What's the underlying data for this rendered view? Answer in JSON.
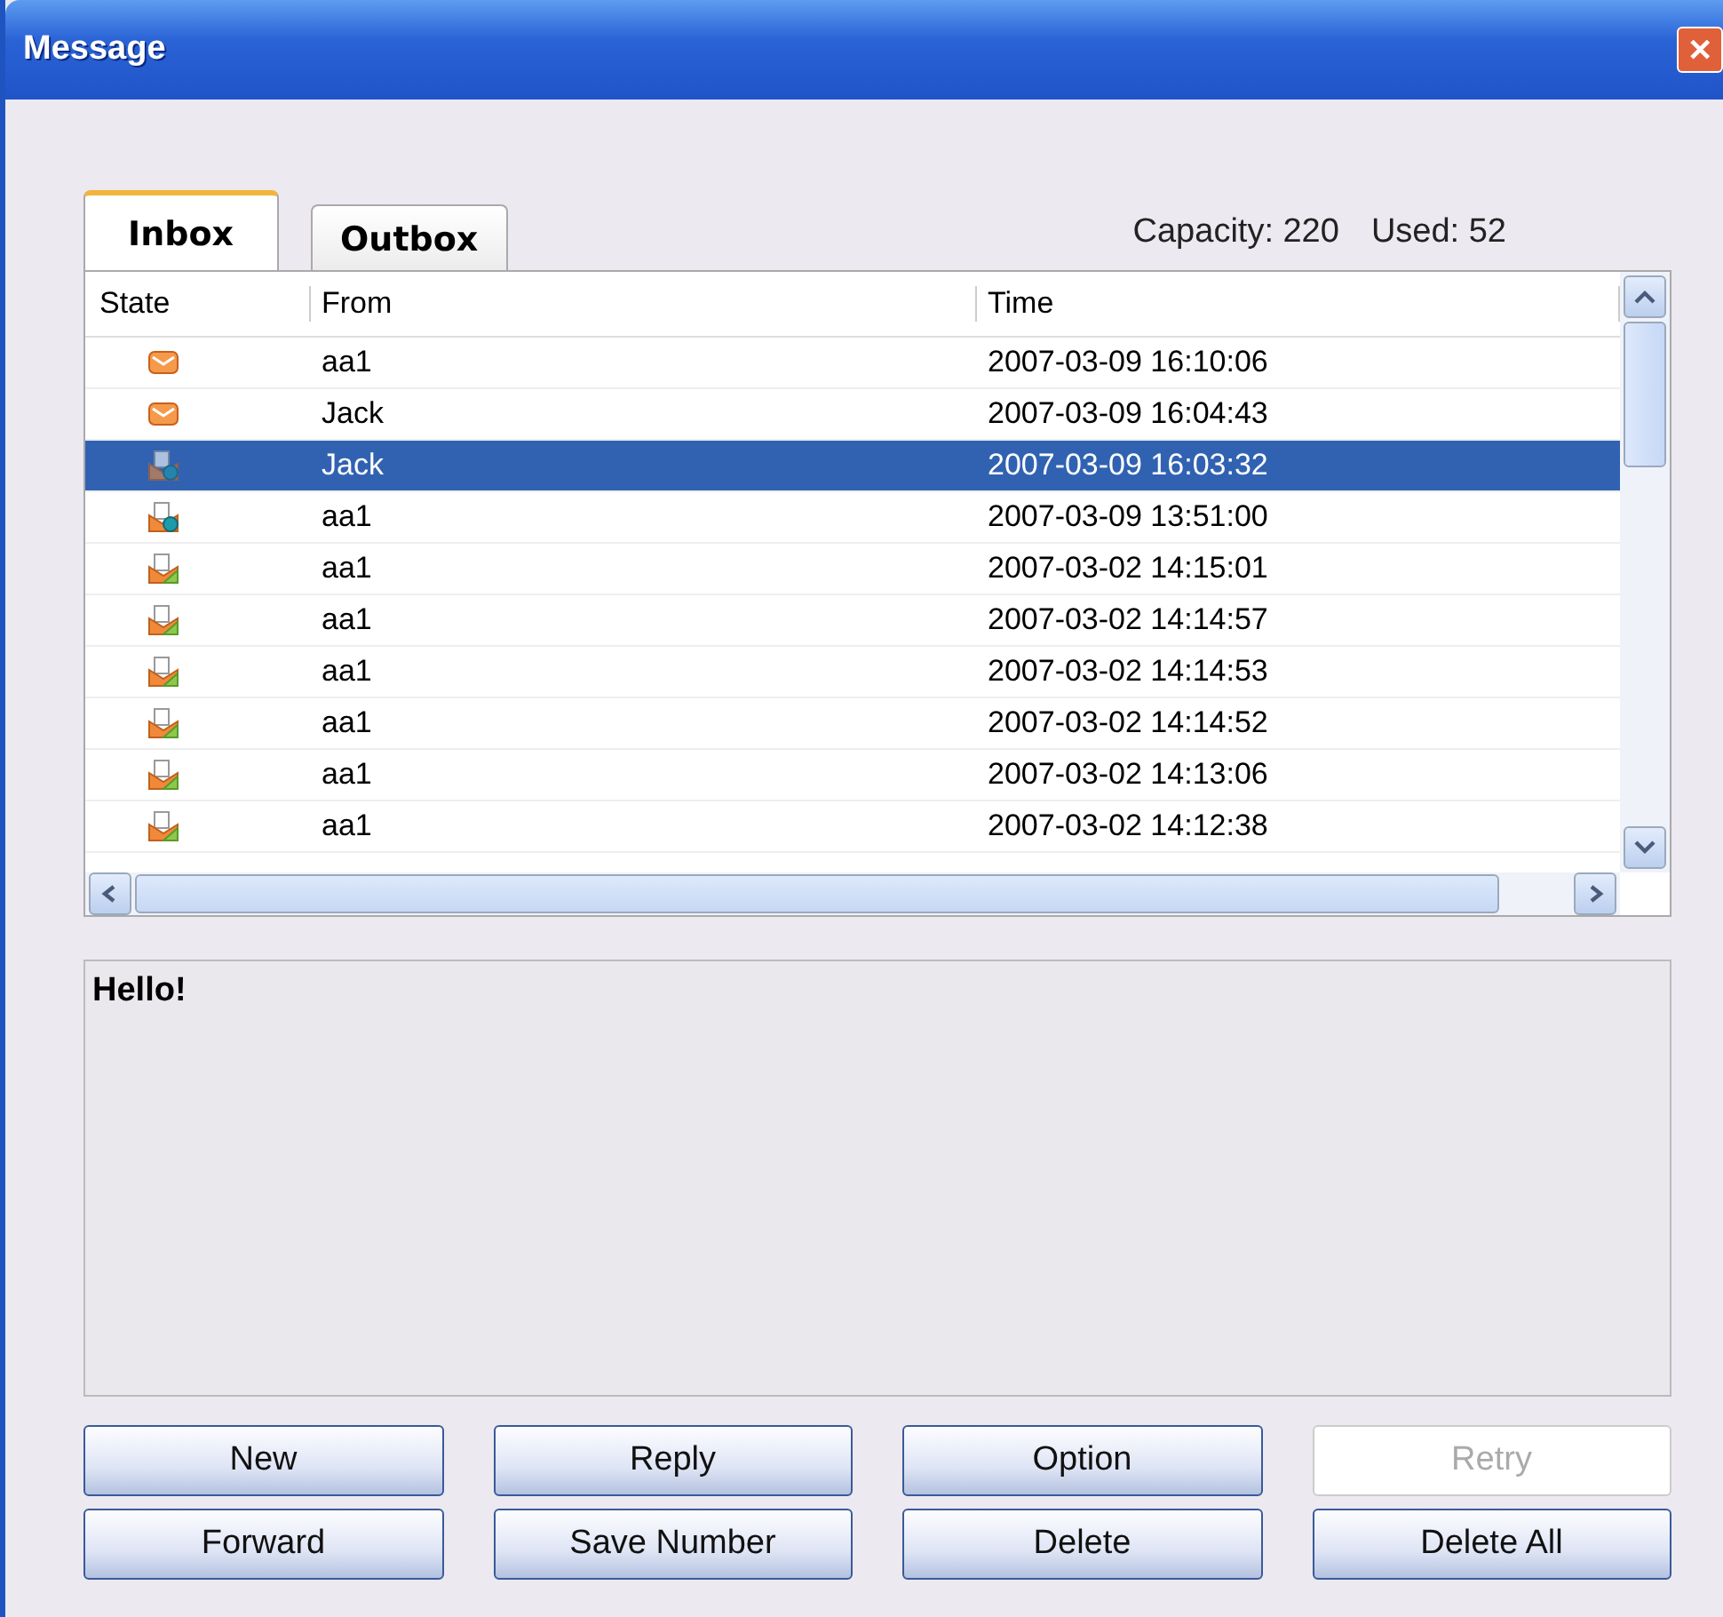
{
  "window": {
    "title": "Message",
    "close": "✕"
  },
  "tabs": [
    {
      "label": "Inbox",
      "selected": true
    },
    {
      "label": "Outbox",
      "selected": false
    }
  ],
  "capacity": {
    "label": "Capacity: 220",
    "used": "Used: 52"
  },
  "table": {
    "columns": [
      "State",
      "From",
      "Time"
    ],
    "rows": [
      {
        "kind": "unread",
        "from": "aa1",
        "time": "2007-03-09 16:10:06",
        "selected": false
      },
      {
        "kind": "unread",
        "from": "Jack",
        "time": "2007-03-09 16:04:43",
        "selected": false
      },
      {
        "kind": "secure",
        "from": "Jack",
        "time": "2007-03-09 16:03:32",
        "selected": true
      },
      {
        "kind": "secure",
        "from": "aa1",
        "time": "2007-03-09 13:51:00",
        "selected": false
      },
      {
        "kind": "read",
        "from": "aa1",
        "time": "2007-03-02 14:15:01",
        "selected": false
      },
      {
        "kind": "read",
        "from": "aa1",
        "time": "2007-03-02 14:14:57",
        "selected": false
      },
      {
        "kind": "read",
        "from": "aa1",
        "time": "2007-03-02 14:14:53",
        "selected": false
      },
      {
        "kind": "read",
        "from": "aa1",
        "time": "2007-03-02 14:14:52",
        "selected": false
      },
      {
        "kind": "read",
        "from": "aa1",
        "time": "2007-03-02 14:13:06",
        "selected": false
      },
      {
        "kind": "read",
        "from": "aa1",
        "time": "2007-03-02 14:12:38",
        "selected": false
      }
    ]
  },
  "message": {
    "text": "Hello!"
  },
  "buttons": [
    {
      "label": "New",
      "disabled": false
    },
    {
      "label": "Reply",
      "disabled": false
    },
    {
      "label": "Option",
      "disabled": false
    },
    {
      "label": "Retry",
      "disabled": true
    },
    {
      "label": "Forward",
      "disabled": false
    },
    {
      "label": "Save Number",
      "disabled": false
    },
    {
      "label": "Delete",
      "disabled": false
    },
    {
      "label": "Delete All",
      "disabled": false
    }
  ]
}
